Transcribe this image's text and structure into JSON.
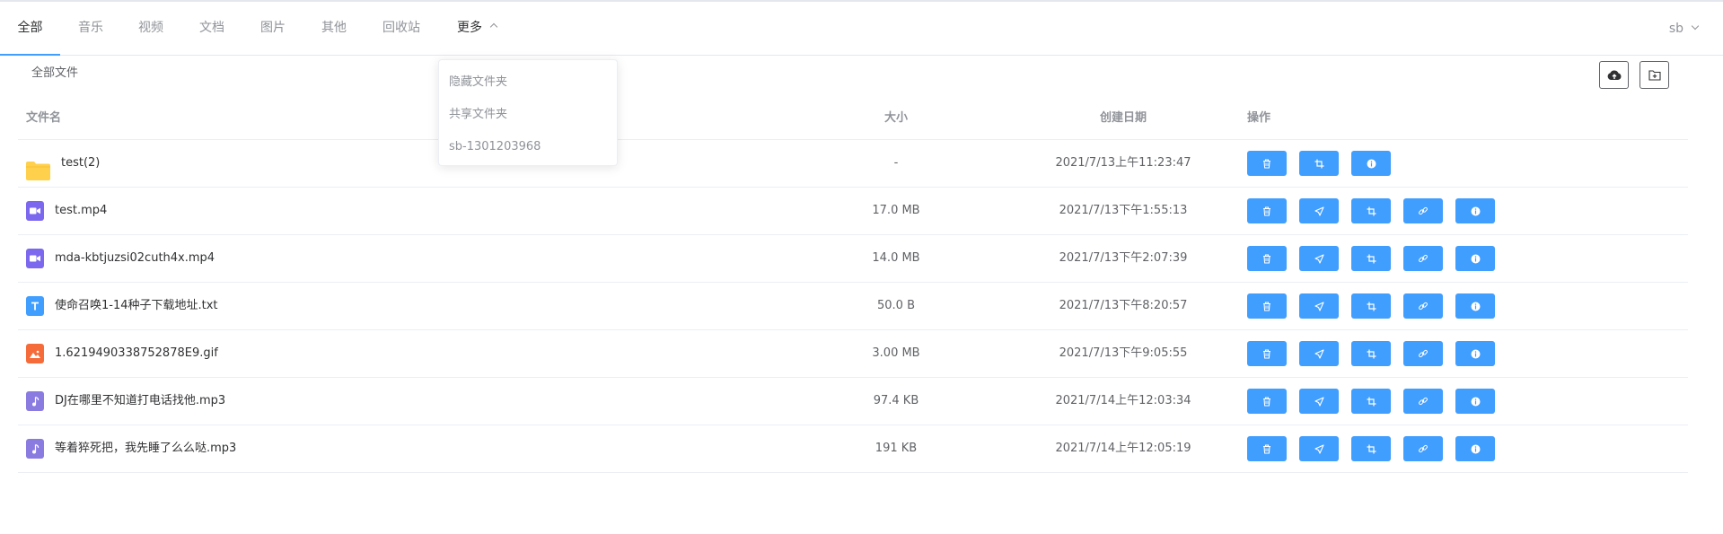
{
  "nav": {
    "tabs": [
      "全部",
      "音乐",
      "视频",
      "文档",
      "图片",
      "其他",
      "回收站"
    ],
    "more_label": "更多",
    "user": "sb"
  },
  "breadcrumb": "全部文件",
  "toolbar": {
    "upload_icon": "cloud-upload-icon",
    "new_folder_icon": "folder-add-icon"
  },
  "table": {
    "headers": {
      "name": "文件名",
      "size": "大小",
      "date": "创建日期",
      "ops": "操作"
    },
    "rows": [
      {
        "name": "test(2)",
        "type": "folder",
        "size": "-",
        "date": "2021/7/13上午11:23:47"
      },
      {
        "name": "test.mp4",
        "type": "video",
        "size": "17.0 MB",
        "date": "2021/7/13下午1:55:13"
      },
      {
        "name": "mda-kbtjuzsi02cuth4x.mp4",
        "type": "video",
        "size": "14.0 MB",
        "date": "2021/7/13下午2:07:39"
      },
      {
        "name": "使命召唤1-14种子下载地址.txt",
        "type": "text",
        "size": "50.0 B",
        "date": "2021/7/13下午8:20:57"
      },
      {
        "name": "1.6219490338752878E9.gif",
        "type": "image",
        "size": "3.00 MB",
        "date": "2021/7/13下午9:05:55"
      },
      {
        "name": "DJ在哪里不知道打电话找他.mp3",
        "type": "audio",
        "size": "97.4 KB",
        "date": "2021/7/14上午12:03:34"
      },
      {
        "name": "等着猝死把，我先睡了么么哒.mp3",
        "type": "audio",
        "size": "191 KB",
        "date": "2021/7/14上午12:05:19"
      }
    ]
  },
  "dropdown": {
    "items": [
      "隐藏文件夹",
      "共享文件夹",
      "sb-1301203968"
    ]
  },
  "colors": {
    "accent": "#409eff",
    "folder": "#ffd04b",
    "video": "#7b68ee",
    "text": "#409eff",
    "image": "#f56c3a",
    "audio": "#8a7be0"
  }
}
